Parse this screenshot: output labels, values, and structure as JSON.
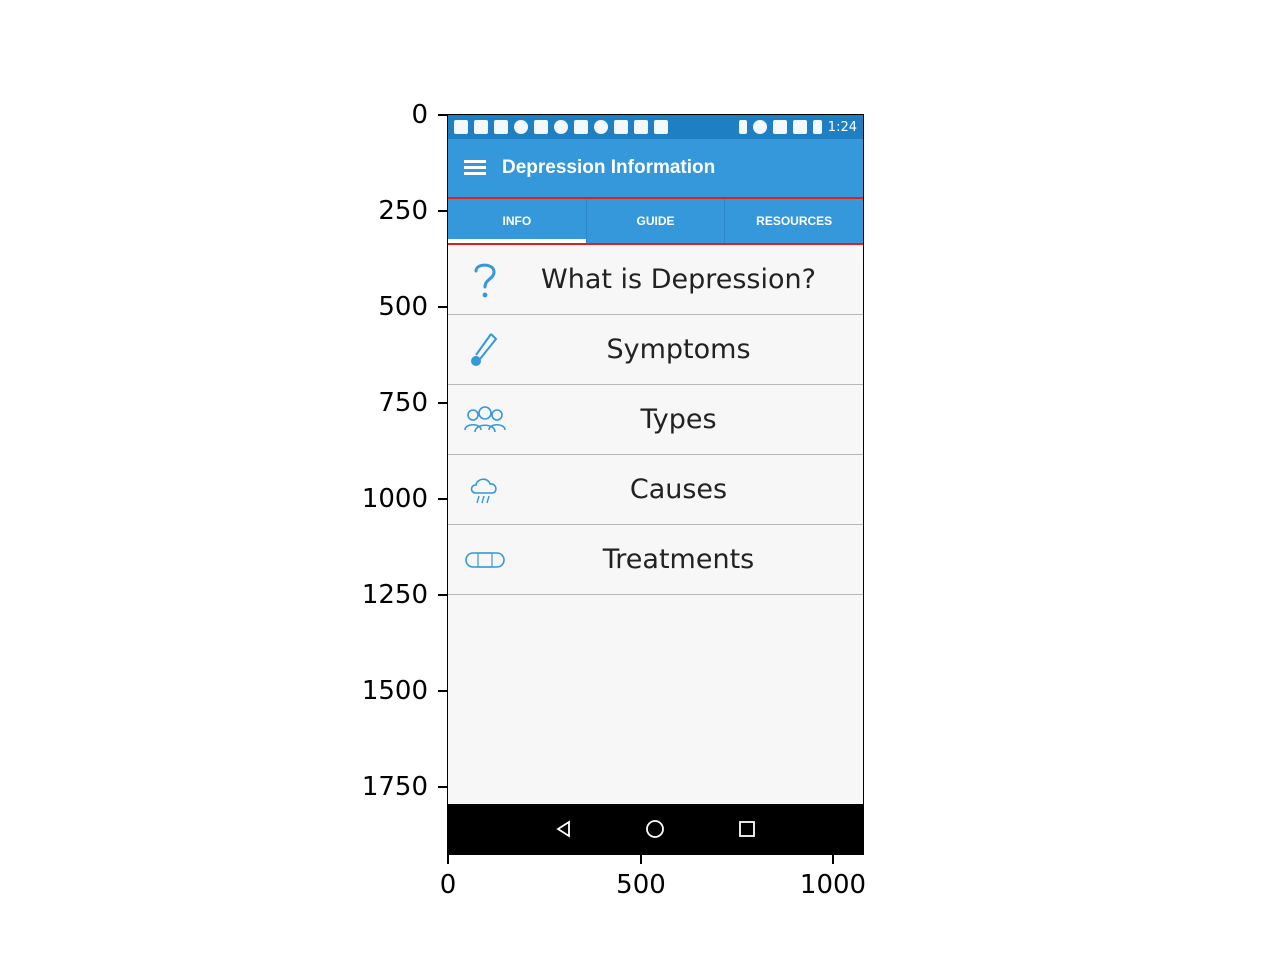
{
  "axes": {
    "y_ticks": [
      "0",
      "250",
      "500",
      "750",
      "1000",
      "1250",
      "1500",
      "1750"
    ],
    "x_ticks": [
      "0",
      "500",
      "1000"
    ]
  },
  "status_bar": {
    "time": "1:24"
  },
  "app_bar": {
    "title": "Depression Information",
    "menu_icon": "hamburger-menu-icon"
  },
  "tabs": [
    {
      "label": "INFO",
      "active": true
    },
    {
      "label": "GUIDE",
      "active": false
    },
    {
      "label": "RESOURCES",
      "active": false
    }
  ],
  "list_items": [
    {
      "label": "What is Depression?",
      "icon": "question-mark-icon"
    },
    {
      "label": "Symptoms",
      "icon": "thermometer-icon"
    },
    {
      "label": "Types",
      "icon": "people-group-icon"
    },
    {
      "label": "Causes",
      "icon": "rain-cloud-icon"
    },
    {
      "label": "Treatments",
      "icon": "bandage-icon"
    }
  ],
  "colors": {
    "app_bar": "#3498db",
    "status_bar": "#1e7fc2",
    "accent_icon": "#3498db",
    "tab_border": "#e02020"
  }
}
